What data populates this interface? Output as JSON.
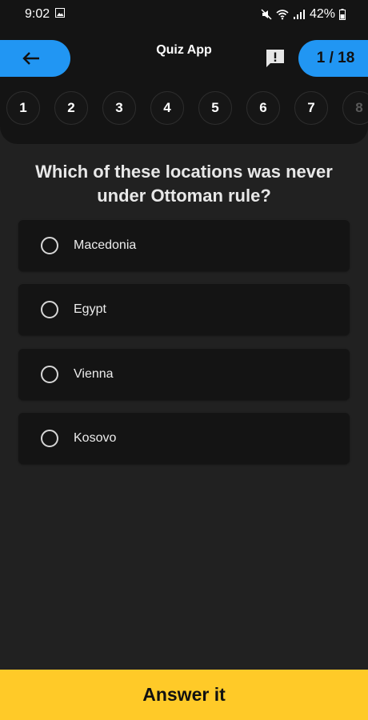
{
  "status_bar": {
    "time": "9:02",
    "battery_percent": "42%",
    "icons": [
      "image-icon",
      "mute-icon",
      "wifi-icon",
      "signal-icon",
      "battery-icon"
    ]
  },
  "header": {
    "app_title": "Quiz App",
    "counter": "1 / 18",
    "back_icon": "arrow-left-icon",
    "report_icon": "report-icon",
    "accent_color": "#2196f3"
  },
  "question_nav": {
    "items": [
      "1",
      "2",
      "3",
      "4",
      "5",
      "6",
      "7",
      "8"
    ],
    "current": "1"
  },
  "question": {
    "text": "Which of these locations was never under Ottoman rule?"
  },
  "options": [
    {
      "label": "Macedonia",
      "selected": false
    },
    {
      "label": "Egypt",
      "selected": false
    },
    {
      "label": "Vienna",
      "selected": false
    },
    {
      "label": "Kosovo",
      "selected": false
    }
  ],
  "answer_button": {
    "label": "Answer it",
    "color": "#ffca28"
  }
}
